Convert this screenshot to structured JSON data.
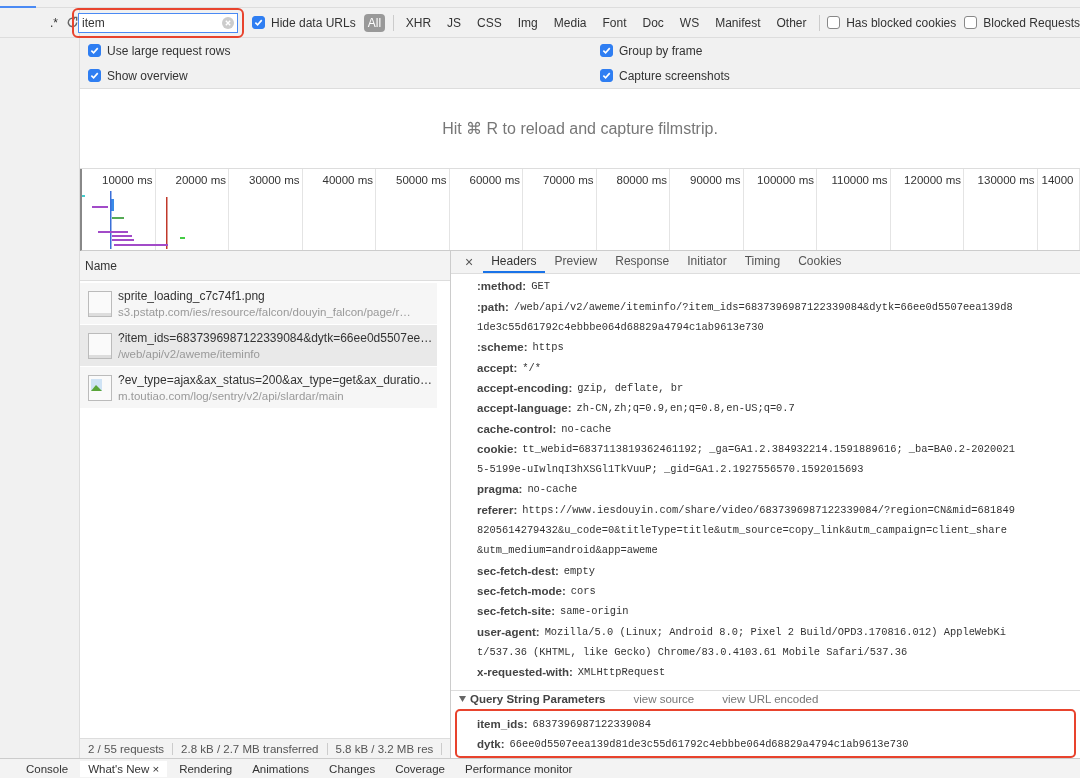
{
  "sidebar": {
    "regex_toggle": ".*"
  },
  "filter": {
    "value": "item",
    "highlighted": true,
    "hide_data_urls": {
      "label": "Hide data URLs",
      "checked": true
    },
    "types": [
      {
        "label": "All",
        "selected": true
      },
      {
        "label": "XHR",
        "selected": false
      },
      {
        "label": "JS",
        "selected": false
      },
      {
        "label": "CSS",
        "selected": false
      },
      {
        "label": "Img",
        "selected": false
      },
      {
        "label": "Media",
        "selected": false
      },
      {
        "label": "Font",
        "selected": false
      },
      {
        "label": "Doc",
        "selected": false
      },
      {
        "label": "WS",
        "selected": false
      },
      {
        "label": "Manifest",
        "selected": false
      },
      {
        "label": "Other",
        "selected": false
      }
    ],
    "checkboxes": [
      {
        "label": "Has blocked cookies",
        "checked": false
      },
      {
        "label": "Blocked Requests",
        "checked": false
      }
    ]
  },
  "settings": [
    {
      "label": "Use large request rows",
      "checked": true
    },
    {
      "label": "Group by frame",
      "checked": true
    },
    {
      "label": "Show overview",
      "checked": true
    },
    {
      "label": "Capture screenshots",
      "checked": true
    }
  ],
  "filmstrip_hint": "Hit ⌘ R to reload and capture filmstrip.",
  "overview": {
    "ticks": [
      "10000 ms",
      "20000 ms",
      "30000 ms",
      "40000 ms",
      "50000 ms",
      "60000 ms",
      "70000 ms",
      "80000 ms",
      "90000 ms",
      "100000 ms",
      "110000 ms",
      "120000 ms",
      "130000 ms",
      "14000"
    ]
  },
  "requests": {
    "column": "Name",
    "rows": [
      {
        "kind": "file",
        "name": "sprite_loading_c7c74f1.png",
        "path": "s3.pstatp.com/ies/resource/falcon/douyin_falcon/page/r…",
        "selected": false
      },
      {
        "kind": "file",
        "name": "?item_ids=6837396987122339084&dytk=66ee0d5507ee…",
        "path": "/web/api/v2/aweme/iteminfo",
        "selected": true
      },
      {
        "kind": "image",
        "name": "?ev_type=ajax&ax_status=200&ax_type=get&ax_duratio…",
        "path": "m.toutiao.com/log/sentry/v2/api/slardar/main",
        "selected": false
      }
    ]
  },
  "status_bar": [
    "2 / 55 requests",
    "2.8 kB / 2.7 MB transferred",
    "5.8 kB / 3.2 MB res"
  ],
  "details": {
    "close": "×",
    "tabs": [
      {
        "label": "Headers",
        "selected": true
      },
      {
        "label": "Preview",
        "selected": false
      },
      {
        "label": "Response",
        "selected": false
      },
      {
        "label": "Initiator",
        "selected": false
      },
      {
        "label": "Timing",
        "selected": false
      },
      {
        "label": "Cookies",
        "selected": false
      }
    ],
    "headers": [
      {
        "name": ":method:",
        "lines": [
          "GET"
        ]
      },
      {
        "name": ":path:",
        "lines": [
          "/web/api/v2/aweme/iteminfo/?item_ids=6837396987122339084&dytk=66ee0d5507eea139d8",
          "1de3c55d61792c4ebbbe064d68829a4794c1ab9613e730"
        ]
      },
      {
        "name": ":scheme:",
        "lines": [
          "https"
        ]
      },
      {
        "name": "accept:",
        "lines": [
          "*/*"
        ]
      },
      {
        "name": "accept-encoding:",
        "lines": [
          "gzip, deflate, br"
        ]
      },
      {
        "name": "accept-language:",
        "lines": [
          "zh-CN,zh;q=0.9,en;q=0.8,en-US;q=0.7"
        ]
      },
      {
        "name": "cache-control:",
        "lines": [
          "no-cache"
        ]
      },
      {
        "name": "cookie:",
        "lines": [
          "tt_webid=6837113819362461192; _ga=GA1.2.384932214.1591889616; _ba=BA0.2-2020021",
          "5-5199e-uIwlnqI3hXSGl1TkVuuP; _gid=GA1.2.1927556570.1592015693"
        ]
      },
      {
        "name": "pragma:",
        "lines": [
          "no-cache"
        ]
      },
      {
        "name": "referer:",
        "lines": [
          "https://www.iesdouyin.com/share/video/6837396987122339084/?region=CN&mid=681849",
          "8205614279432&u_code=0&titleType=title&utm_source=copy_link&utm_campaign=client_share",
          "&utm_medium=android&app=aweme"
        ]
      },
      {
        "name": "sec-fetch-dest:",
        "lines": [
          "empty"
        ]
      },
      {
        "name": "sec-fetch-mode:",
        "lines": [
          "cors"
        ]
      },
      {
        "name": "sec-fetch-site:",
        "lines": [
          "same-origin"
        ]
      },
      {
        "name": "user-agent:",
        "lines": [
          "Mozilla/5.0 (Linux; Android 8.0; Pixel 2 Build/OPD3.170816.012) AppleWebKi",
          "t/537.36 (KHTML, like Gecko) Chrome/83.0.4103.61 Mobile Safari/537.36"
        ]
      },
      {
        "name": "x-requested-with:",
        "lines": [
          "XMLHttpRequest"
        ]
      }
    ],
    "query": {
      "title": "Query String Parameters",
      "expanded": true,
      "links": [
        "view source",
        "view URL encoded"
      ],
      "highlighted": true,
      "params": [
        {
          "name": "item_ids:",
          "value": "6837396987122339084"
        },
        {
          "name": "dytk:",
          "value": "66ee0d5507eea139d81de3c55d61792c4ebbbe064d68829a4794c1ab9613e730"
        }
      ]
    }
  },
  "drawer_tabs": [
    {
      "label": "Console",
      "selected": false
    },
    {
      "label": "What's New",
      "selected": true,
      "close": "×"
    },
    {
      "label": "Rendering",
      "selected": false
    },
    {
      "label": "Animations",
      "selected": false
    },
    {
      "label": "Changes",
      "selected": false
    },
    {
      "label": "Coverage",
      "selected": false
    },
    {
      "label": "Performance monitor",
      "selected": false
    }
  ]
}
